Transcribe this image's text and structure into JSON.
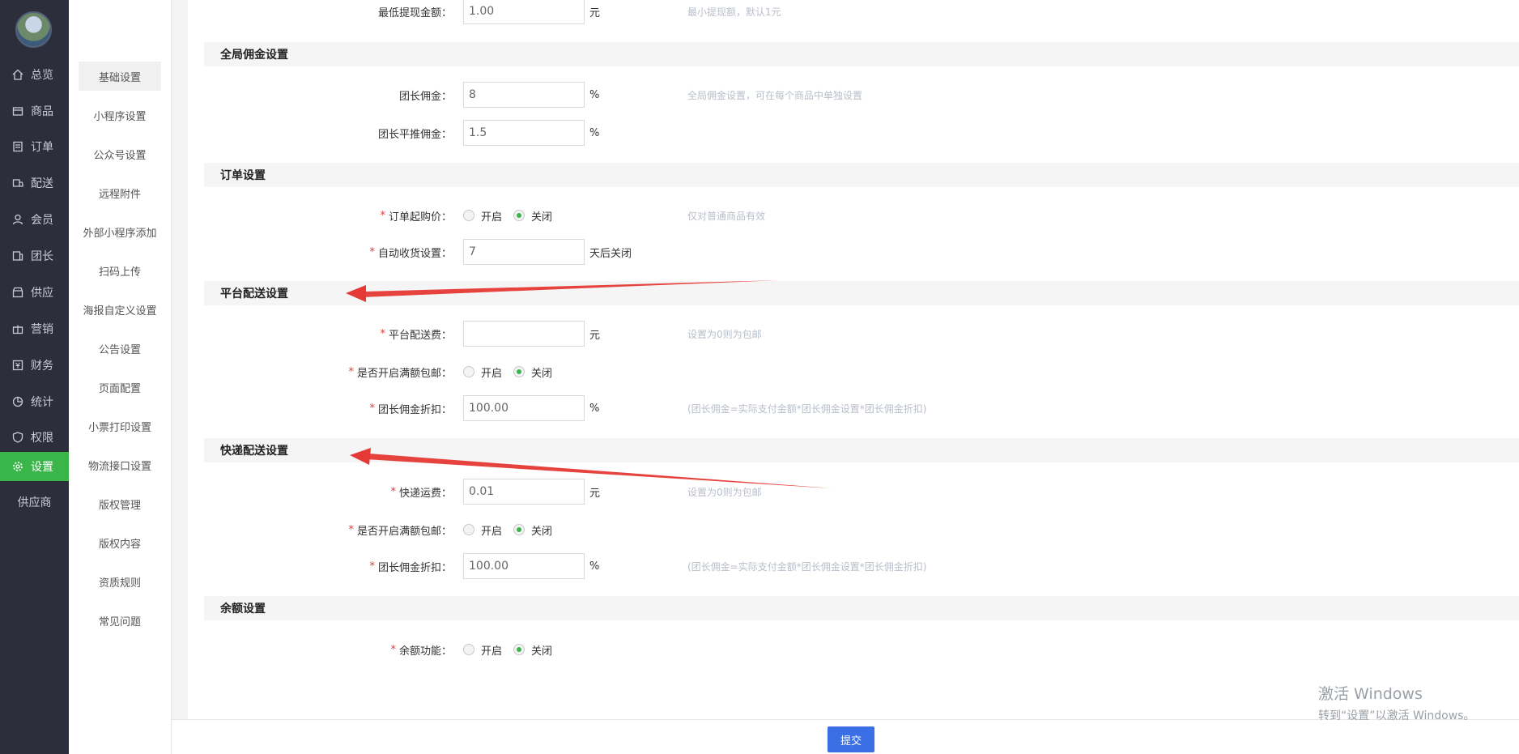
{
  "nav": {
    "items": [
      {
        "label": "总览",
        "icon": "home-icon"
      },
      {
        "label": "商品",
        "icon": "box-icon"
      },
      {
        "label": "订单",
        "icon": "order-icon"
      },
      {
        "label": "配送",
        "icon": "delivery-icon"
      },
      {
        "label": "会员",
        "icon": "user-icon"
      },
      {
        "label": "团长",
        "icon": "leader-icon"
      },
      {
        "label": "供应",
        "icon": "store-icon"
      },
      {
        "label": "营销",
        "icon": "gift-icon"
      },
      {
        "label": "财务",
        "icon": "finance-icon"
      },
      {
        "label": "统计",
        "icon": "chart-icon"
      },
      {
        "label": "权限",
        "icon": "shield-icon"
      },
      {
        "label": "设置",
        "icon": "gear-icon"
      },
      {
        "label": "供应商",
        "icon": ""
      }
    ],
    "active_color": "#39b54a"
  },
  "subnav": {
    "items": [
      "基础设置",
      "小程序设置",
      "公众号设置",
      "远程附件",
      "外部小程序添加",
      "扫码上传",
      "海报自定义设置",
      "公告设置",
      "页面配置",
      "小票打印设置",
      "物流接口设置",
      "版权管理",
      "版权内容",
      "资质规则",
      "常见问题"
    ]
  },
  "form": {
    "min_withdraw": {
      "label": "最低提现金额：",
      "value": "1.00",
      "unit": "元",
      "hint": "最小提现额，默认1元"
    },
    "global_commission": {
      "title": "全局佣金设置",
      "leader": {
        "label": "团长佣金：",
        "value": "8",
        "unit": "%",
        "hint": "全局佣金设置，可在每个商品中单独设置"
      },
      "leader_push": {
        "label": "团长平推佣金：",
        "value": "1.5",
        "unit": "%"
      }
    },
    "order": {
      "title": "订单设置",
      "min_price": {
        "label": "订单起购价：",
        "on": "开启",
        "off": "关闭",
        "hint": "仅对普通商品有效"
      },
      "auto_receive": {
        "label": "自动收货设置：",
        "value": "7",
        "unit": "天后关闭"
      }
    },
    "platform_delivery": {
      "title": "平台配送设置",
      "fee": {
        "label": "平台配送费：",
        "value": "",
        "unit": "元",
        "hint": "设置为0则为包邮"
      },
      "free_ship": {
        "label": "是否开启满额包邮：",
        "on": "开启",
        "off": "关闭"
      },
      "discount": {
        "label": "团长佣金折扣：",
        "value": "100.00",
        "unit": "%",
        "hint": "(团长佣金=实际支付金额*团长佣金设置*团长佣金折扣)"
      }
    },
    "express": {
      "title": "快递配送设置",
      "fee": {
        "label": "快递运费：",
        "value": "0.01",
        "unit": "元",
        "hint": "设置为0则为包邮"
      },
      "free_ship": {
        "label": "是否开启满额包邮：",
        "on": "开启",
        "off": "关闭"
      },
      "discount": {
        "label": "团长佣金折扣：",
        "value": "100.00",
        "unit": "%",
        "hint": "(团长佣金=实际支付金额*团长佣金设置*团长佣金折扣)"
      }
    },
    "balance": {
      "title": "余额设置",
      "feature": {
        "label": "余额功能：",
        "on": "开启",
        "off": "关闭"
      }
    }
  },
  "footer": {
    "submit_label": "提交",
    "button_color": "#3b6fe6"
  },
  "watermark": {
    "line1": "激活 Windows",
    "line2": "转到“设置”以激活 Windows。"
  },
  "annotation_color": "#e53935"
}
